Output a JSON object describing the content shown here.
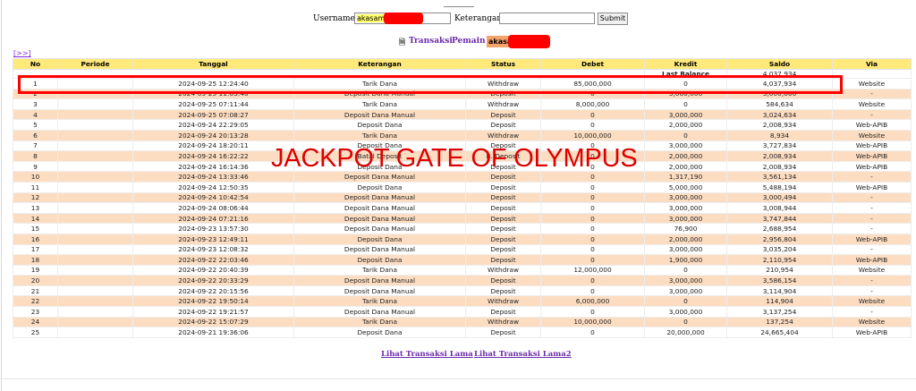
{
  "form": {
    "username_label": "Username :",
    "username_value": "akasame",
    "keterangan_label": "Keterangan :",
    "keterangan_value": "",
    "submit_label": "Submit"
  },
  "title": {
    "icon": "document-icon",
    "transaksi_label": "Transaksi",
    "pemain_label": "Pemain :",
    "pemain_value": "akasa"
  },
  "nav": {
    "next_label": "[>>]"
  },
  "table": {
    "headers": [
      "No",
      "Periode",
      "Tanggal",
      "Keterangan",
      "Status",
      "Debet",
      "Kredit",
      "Saldo",
      "Via"
    ],
    "last_balance": {
      "label": "Last Balance",
      "saldo": "4,037,934"
    },
    "rows": [
      {
        "no": "1",
        "periode": "",
        "tanggal": "2024-09-25 12:24:40",
        "keterangan": "Tarik Dana",
        "status": "Withdraw",
        "debet": "85,000,000",
        "kredit": "0",
        "saldo": "4,037,934",
        "via": "Website"
      },
      {
        "no": "2",
        "periode": "",
        "tanggal": "2024-09-25 11:03:40",
        "keterangan": "Deposit Dana Manual",
        "status": "Deposit",
        "debet": "0",
        "kredit": "3,000,000",
        "saldo": "3,000,000",
        "via": "-"
      },
      {
        "no": "3",
        "periode": "",
        "tanggal": "2024-09-25 07:11:44",
        "keterangan": "Tarik Dana",
        "status": "Withdraw",
        "debet": "8,000,000",
        "kredit": "0",
        "saldo": "584,634",
        "via": "Website"
      },
      {
        "no": "4",
        "periode": "",
        "tanggal": "2024-09-25 07:08:27",
        "keterangan": "Deposit Dana Manual",
        "status": "Deposit",
        "debet": "0",
        "kredit": "3,000,000",
        "saldo": "3,024,634",
        "via": "-"
      },
      {
        "no": "5",
        "periode": "",
        "tanggal": "2024-09-24 22:29:05",
        "keterangan": "Deposit Dana",
        "status": "Deposit",
        "debet": "0",
        "kredit": "2,000,000",
        "saldo": "2,008,934",
        "via": "Web-APIB"
      },
      {
        "no": "6",
        "periode": "",
        "tanggal": "2024-09-24 20:13:28",
        "keterangan": "Tarik Dana",
        "status": "Withdraw",
        "debet": "10,000,000",
        "kredit": "0",
        "saldo": "8,934",
        "via": "Website"
      },
      {
        "no": "7",
        "periode": "",
        "tanggal": "2024-09-24 18:20:11",
        "keterangan": "Deposit Dana",
        "status": "Deposit",
        "debet": "0",
        "kredit": "3,000,000",
        "saldo": "3,727,834",
        "via": "Web-APIB"
      },
      {
        "no": "8",
        "periode": "",
        "tanggal": "2024-09-24 16:22:22",
        "keterangan": "Batal Deposit",
        "status": "B. Deposit",
        "debet": "0",
        "kredit": "2,000,000",
        "saldo": "2,008,934",
        "via": "Web-APIB"
      },
      {
        "no": "9",
        "periode": "",
        "tanggal": "2024-09-24 16:14:36",
        "keterangan": "Deposit Dana",
        "status": "Deposit",
        "debet": "0",
        "kredit": "2,000,000",
        "saldo": "2,008,934",
        "via": "Web-APIB"
      },
      {
        "no": "10",
        "periode": "",
        "tanggal": "2024-09-24 13:33:46",
        "keterangan": "Deposit Dana Manual",
        "status": "Deposit",
        "debet": "0",
        "kredit": "1,317,190",
        "saldo": "3,561,134",
        "via": "-"
      },
      {
        "no": "11",
        "periode": "",
        "tanggal": "2024-09-24 12:50:35",
        "keterangan": "Deposit Dana",
        "status": "Deposit",
        "debet": "0",
        "kredit": "5,000,000",
        "saldo": "5,488,194",
        "via": "Web-APIB"
      },
      {
        "no": "12",
        "periode": "",
        "tanggal": "2024-09-24 10:42:54",
        "keterangan": "Deposit Dana Manual",
        "status": "Deposit",
        "debet": "0",
        "kredit": "3,000,000",
        "saldo": "3,000,494",
        "via": "-"
      },
      {
        "no": "13",
        "periode": "",
        "tanggal": "2024-09-24 08:06:44",
        "keterangan": "Deposit Dana Manual",
        "status": "Deposit",
        "debet": "0",
        "kredit": "3,000,000",
        "saldo": "3,008,944",
        "via": "-"
      },
      {
        "no": "14",
        "periode": "",
        "tanggal": "2024-09-24 07:21:16",
        "keterangan": "Deposit Dana Manual",
        "status": "Deposit",
        "debet": "0",
        "kredit": "3,000,000",
        "saldo": "3,747,844",
        "via": "-"
      },
      {
        "no": "15",
        "periode": "",
        "tanggal": "2024-09-23 13:57:30",
        "keterangan": "Deposit Dana Manual",
        "status": "Deposit",
        "debet": "0",
        "kredit": "76,900",
        "saldo": "2,688,954",
        "via": "-"
      },
      {
        "no": "16",
        "periode": "",
        "tanggal": "2024-09-23 12:49:11",
        "keterangan": "Deposit Dana",
        "status": "Deposit",
        "debet": "0",
        "kredit": "2,000,000",
        "saldo": "2,956,804",
        "via": "Web-APIB"
      },
      {
        "no": "17",
        "periode": "",
        "tanggal": "2024-09-23 12:08:32",
        "keterangan": "Deposit Dana Manual",
        "status": "Deposit",
        "debet": "0",
        "kredit": "3,000,000",
        "saldo": "3,035,204",
        "via": "-"
      },
      {
        "no": "18",
        "periode": "",
        "tanggal": "2024-09-22 22:03:46",
        "keterangan": "Deposit Dana",
        "status": "Deposit",
        "debet": "0",
        "kredit": "1,900,000",
        "saldo": "2,110,954",
        "via": "Web-APIB"
      },
      {
        "no": "19",
        "periode": "",
        "tanggal": "2024-09-22 20:40:39",
        "keterangan": "Tarik Dana",
        "status": "Withdraw",
        "debet": "12,000,000",
        "kredit": "0",
        "saldo": "210,954",
        "via": "Website"
      },
      {
        "no": "20",
        "periode": "",
        "tanggal": "2024-09-22 20:33:29",
        "keterangan": "Deposit Dana Manual",
        "status": "Deposit",
        "debet": "0",
        "kredit": "3,000,000",
        "saldo": "3,586,154",
        "via": "-"
      },
      {
        "no": "21",
        "periode": "",
        "tanggal": "2024-09-22 20:15:56",
        "keterangan": "Deposit Dana Manual",
        "status": "Deposit",
        "debet": "0",
        "kredit": "3,000,000",
        "saldo": "3,114,904",
        "via": "-"
      },
      {
        "no": "22",
        "periode": "",
        "tanggal": "2024-09-22 19:50:14",
        "keterangan": "Tarik Dana",
        "status": "Withdraw",
        "debet": "6,000,000",
        "kredit": "0",
        "saldo": "114,904",
        "via": "Website"
      },
      {
        "no": "23",
        "periode": "",
        "tanggal": "2024-09-22 19:21:57",
        "keterangan": "Deposit Dana Manual",
        "status": "Deposit",
        "debet": "0",
        "kredit": "3,000,000",
        "saldo": "3,137,254",
        "via": "-"
      },
      {
        "no": "24",
        "periode": "",
        "tanggal": "2024-09-22 15:07:29",
        "keterangan": "Tarik Dana",
        "status": "Withdraw",
        "debet": "10,000,000",
        "kredit": "0",
        "saldo": "137,254",
        "via": "Website"
      },
      {
        "no": "25",
        "periode": "",
        "tanggal": "2024-09-21 19:36:06",
        "keterangan": "Deposit Dana",
        "status": "Deposit",
        "debet": "0",
        "kredit": "20,000,000",
        "saldo": "24,665,404",
        "via": "Web-APIB"
      }
    ]
  },
  "overlay_text": "JACKPOT GATE OF OLYMPUS",
  "footer": {
    "link1": "Lihat Transaksi Lama",
    "link2": "Lihat Transaksi Lama2"
  },
  "colors": {
    "header_bg": "#ffe97a",
    "row_alt_bg": "#fdddc1",
    "withdraw": "#b040b0",
    "deposit": "#ee2222",
    "amount_purple": "#7b22dc",
    "highlight_red": "#ff0000"
  }
}
